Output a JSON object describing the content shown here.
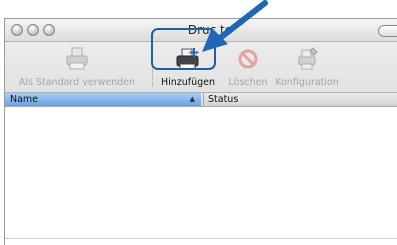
{
  "window": {
    "title": "Drucker-Liste",
    "title_visible": "Druc        te"
  },
  "toolbar": {
    "default_label": "Als Standard verwenden",
    "add_label": "Hinzufügen",
    "delete_label": "Löschen",
    "config_label": "Konfiguration"
  },
  "table": {
    "columns": [
      {
        "label": "Name",
        "sorted": true
      },
      {
        "label": "Status"
      }
    ],
    "rows": []
  },
  "colors": {
    "highlight": "#1f5fa8",
    "arrow": "#1f66b5",
    "header_selected": "#6aa2e4"
  },
  "icons": [
    "printer-icon",
    "add-printer-icon",
    "delete-icon",
    "configure-icon",
    "pointer-arrow"
  ]
}
